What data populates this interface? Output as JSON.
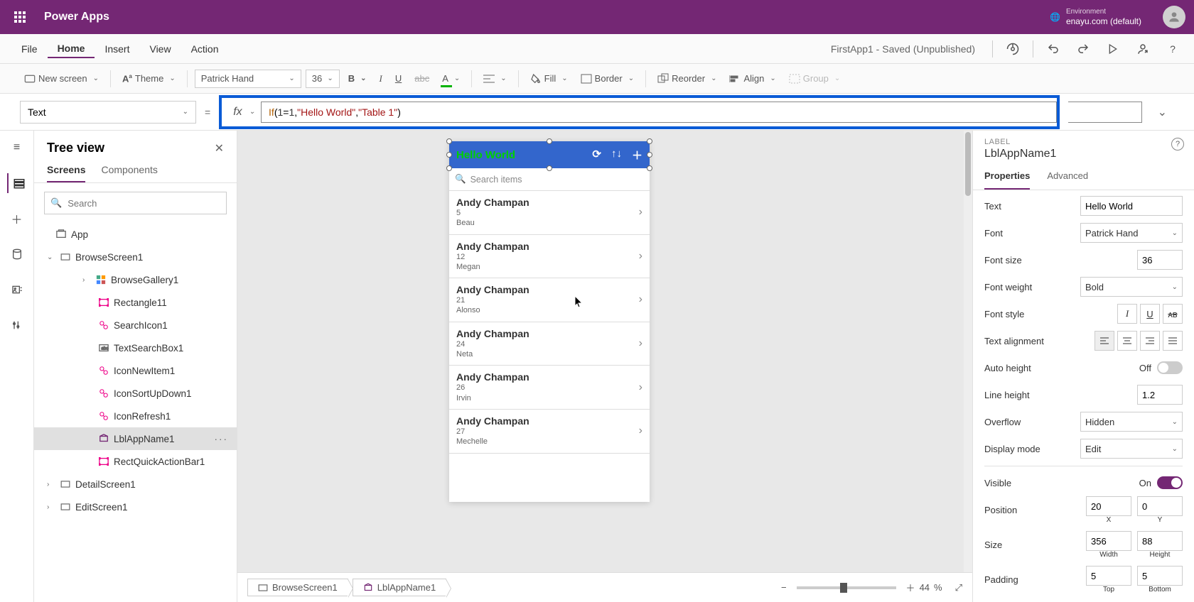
{
  "topbar": {
    "title": "Power Apps",
    "env_label": "Environment",
    "env_name": "enayu.com (default)"
  },
  "menu": {
    "items": [
      "File",
      "Home",
      "Insert",
      "View",
      "Action"
    ],
    "active": "Home",
    "status_app": "FirstApp1",
    "status_state": "Saved (Unpublished)"
  },
  "toolbar": {
    "new_screen": "New screen",
    "theme": "Theme",
    "font_name": "Patrick Hand",
    "font_size": "36",
    "fill": "Fill",
    "border": "Border",
    "reorder": "Reorder",
    "align": "Align",
    "group": "Group"
  },
  "formula": {
    "property": "Text",
    "fx": "fx",
    "expr_if": "If",
    "expr_open": "(",
    "expr_cond": "1",
    "expr_eq": "=",
    "expr_cond2": "1",
    "expr_c": ", ",
    "expr_s1": "\"Hello World\"",
    "expr_c2": ", ",
    "expr_s2": "\"Table 1\"",
    "expr_close": ")"
  },
  "tree": {
    "title": "Tree view",
    "tabs": [
      "Screens",
      "Components"
    ],
    "active": "Screens",
    "search_placeholder": "Search",
    "nodes": [
      {
        "label": "App",
        "indent": 0,
        "kind": "app"
      },
      {
        "label": "BrowseScreen1",
        "indent": 1,
        "kind": "screen",
        "expanded": true
      },
      {
        "label": "BrowseGallery1",
        "indent": 2,
        "kind": "gallery",
        "caret": true
      },
      {
        "label": "Rectangle11",
        "indent": 3,
        "kind": "rect"
      },
      {
        "label": "SearchIcon1",
        "indent": 3,
        "kind": "iconctl"
      },
      {
        "label": "TextSearchBox1",
        "indent": 3,
        "kind": "textbox"
      },
      {
        "label": "IconNewItem1",
        "indent": 3,
        "kind": "iconctl"
      },
      {
        "label": "IconSortUpDown1",
        "indent": 3,
        "kind": "iconctl"
      },
      {
        "label": "IconRefresh1",
        "indent": 3,
        "kind": "iconctl"
      },
      {
        "label": "LblAppName1",
        "indent": 3,
        "kind": "label",
        "selected": true
      },
      {
        "label": "RectQuickActionBar1",
        "indent": 3,
        "kind": "rect"
      },
      {
        "label": "DetailScreen1",
        "indent": 1,
        "kind": "screen",
        "caret": true
      },
      {
        "label": "EditScreen1",
        "indent": 1,
        "kind": "screen",
        "caret": true
      }
    ]
  },
  "phone": {
    "header_title": "Hello World",
    "search_placeholder": "Search items",
    "rows": [
      {
        "title": "Andy Champan",
        "line1": "5",
        "line2": "Beau"
      },
      {
        "title": "Andy Champan",
        "line1": "12",
        "line2": "Megan"
      },
      {
        "title": "Andy Champan",
        "line1": "21",
        "line2": "Alonso"
      },
      {
        "title": "Andy Champan",
        "line1": "24",
        "line2": "Neta"
      },
      {
        "title": "Andy Champan",
        "line1": "26",
        "line2": "Irvin"
      },
      {
        "title": "Andy Champan",
        "line1": "27",
        "line2": "Mechelle"
      }
    ]
  },
  "status": {
    "crumb1": "BrowseScreen1",
    "crumb2": "LblAppName1",
    "zoom": "44",
    "pct": "%"
  },
  "props": {
    "kind": "LABEL",
    "name": "LblAppName1",
    "tabs": [
      "Properties",
      "Advanced"
    ],
    "active": "Properties",
    "text_label": "Text",
    "text_value": "Hello World",
    "font_label": "Font",
    "font_value": "Patrick Hand",
    "size_label": "Font size",
    "size_value": "36",
    "weight_label": "Font weight",
    "weight_value": "Bold",
    "style_label": "Font style",
    "align_label": "Text alignment",
    "autoh_label": "Auto height",
    "autoh_state": "Off",
    "lineh_label": "Line height",
    "lineh_value": "1.2",
    "overflow_label": "Overflow",
    "overflow_value": "Hidden",
    "dmode_label": "Display mode",
    "dmode_value": "Edit",
    "visible_label": "Visible",
    "visible_state": "On",
    "pos_label": "Position",
    "pos_x": "20",
    "pos_y": "0",
    "pos_xl": "X",
    "pos_yl": "Y",
    "size2_label": "Size",
    "size_w": "356",
    "size_h": "88",
    "size_wl": "Width",
    "size_hl": "Height",
    "pad_label": "Padding",
    "pad_t": "5",
    "pad_b": "5",
    "pad_tl": "Top",
    "pad_bl": "Bottom"
  }
}
